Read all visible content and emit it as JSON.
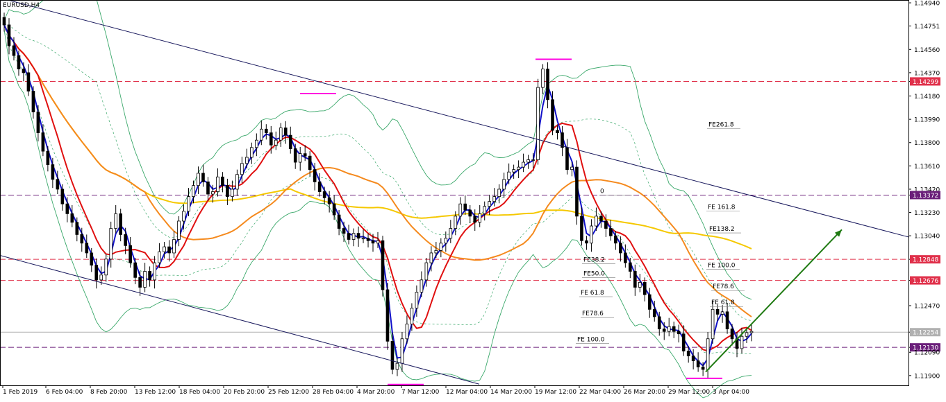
{
  "symbol_label": "EURUSD,H4",
  "chart_data": {
    "type": "candlestick",
    "symbol": "EURUSD",
    "timeframe": "H4",
    "y_range": [
      1.1183,
      1.1496
    ],
    "y_ticks": [
      1.1494,
      1.14751,
      1.1456,
      1.1437,
      1.14299,
      1.1418,
      1.1399,
      1.138,
      1.1361,
      1.1342,
      1.13372,
      1.1323,
      1.1304,
      1.12848,
      1.12676,
      1.1247,
      1.12254,
      1.1213,
      1.1209,
      1.119
    ],
    "y_tick_labels": [
      "1.14940",
      "1.14751",
      "1.14560",
      "1.14370",
      "1.14299",
      "1.14180",
      "1.13990",
      "1.13800",
      "1.13610",
      "1.13420",
      "1.13372",
      "1.13230",
      "1.13040",
      "1.12848",
      "1.12676",
      "1.12470",
      "1.12254",
      "1.12130",
      "1.12090",
      "1.11900"
    ],
    "highlighted_levels": [
      {
        "label": "1.14299",
        "value": 1.14299,
        "color": "#e0304a"
      },
      {
        "label": "1.13372",
        "value": 1.13372,
        "color": "#6a1f7a"
      },
      {
        "label": "1.12848",
        "value": 1.12848,
        "color": "#e0304a"
      },
      {
        "label": "1.12676",
        "value": 1.12676,
        "color": "#e0304a"
      },
      {
        "label": "1.12254",
        "value": 1.12254,
        "color": "#b0b0b0"
      },
      {
        "label": "1.12130",
        "value": 1.1213,
        "color": "#6a1f7a"
      }
    ],
    "x_labels": [
      "1 Feb 2019",
      "6 Feb 04:00",
      "8 Feb 20:00",
      "13 Feb 12:00",
      "18 Feb 04:00",
      "20 Feb 20:00",
      "25 Feb 12:00",
      "28 Feb 04:00",
      "4 Mar 20:00",
      "7 Mar 12:00",
      "12 Mar 04:00",
      "14 Mar 20:00",
      "19 Mar 12:00",
      "22 Mar 04:00",
      "26 Mar 20:00",
      "29 Mar 12:00",
      "3 Apr 04:00"
    ],
    "fib_labels": [
      {
        "text": "FE261.8",
        "value": 1.1393
      },
      {
        "text": "FE 161.8",
        "value": 1.1326
      },
      {
        "text": "FE138.2",
        "value": 1.1308
      },
      {
        "text": "FE 100.0",
        "value": 1.12785
      },
      {
        "text": "FE78.6",
        "value": 1.1261
      },
      {
        "text": "FE 61.8",
        "value": 1.1248
      },
      {
        "text": "FE38.2",
        "value": 1.1283
      },
      {
        "text": "FE50.0",
        "value": 1.12715
      },
      {
        "text": "FE 61.8",
        "value": 1.1256
      },
      {
        "text": "FE78.6",
        "value": 1.1239
      },
      {
        "text": "FE 100.0",
        "value": 1.1218
      },
      {
        "text": "0",
        "value": 1.1339
      }
    ],
    "swing_markers": [
      {
        "kind": "high",
        "value": 1.142
      },
      {
        "kind": "low",
        "value": 1.11827
      },
      {
        "kind": "high",
        "value": 1.1448
      },
      {
        "kind": "low",
        "value": 1.11877
      }
    ],
    "series": [
      {
        "name": "close",
        "color": "#000000",
        "values": [
          1.1476,
          1.1459,
          1.1451,
          1.144,
          1.1437,
          1.1422,
          1.1405,
          1.1388,
          1.1373,
          1.1362,
          1.135,
          1.1342,
          1.133,
          1.1322,
          1.1315,
          1.1305,
          1.1298,
          1.129,
          1.128,
          1.1268,
          1.1272,
          1.1285,
          1.131,
          1.1322,
          1.1305,
          1.1296,
          1.1282,
          1.127,
          1.1262,
          1.1275,
          1.1268,
          1.1282,
          1.1291,
          1.1295,
          1.129,
          1.1301,
          1.1316,
          1.1324,
          1.1336,
          1.1345,
          1.1355,
          1.1348,
          1.1338,
          1.134,
          1.1352,
          1.1345,
          1.1336,
          1.1342,
          1.1354,
          1.1363,
          1.1368,
          1.1376,
          1.1382,
          1.1391,
          1.1388,
          1.1378,
          1.1382,
          1.1392,
          1.1386,
          1.1375,
          1.1364,
          1.1371,
          1.1369,
          1.1358,
          1.1348,
          1.134,
          1.1335,
          1.133,
          1.1321,
          1.131,
          1.1306,
          1.1301,
          1.1306,
          1.1302,
          1.1302,
          1.13,
          1.1298,
          1.13,
          1.126,
          1.1218,
          1.1195,
          1.12,
          1.122,
          1.1232,
          1.1245,
          1.1258,
          1.1268,
          1.1282,
          1.129,
          1.1292,
          1.1298,
          1.1302,
          1.131,
          1.132,
          1.133,
          1.1325,
          1.132,
          1.1315,
          1.1322,
          1.1328,
          1.1332,
          1.1336,
          1.1342,
          1.135,
          1.1356,
          1.1358,
          1.136,
          1.1364,
          1.1366,
          1.1366,
          1.1425,
          1.144,
          1.1415,
          1.139,
          1.1388,
          1.1376,
          1.1358,
          1.136,
          1.132,
          1.13,
          1.1298,
          1.1312,
          1.132,
          1.1316,
          1.131,
          1.1304,
          1.1298,
          1.129,
          1.1282,
          1.1275,
          1.1262,
          1.1266,
          1.1256,
          1.1244,
          1.1238,
          1.1228,
          1.1226,
          1.123,
          1.1226,
          1.1224,
          1.121,
          1.1206,
          1.1202,
          1.1197,
          1.1195,
          1.122,
          1.1244,
          1.124,
          1.1242,
          1.1228,
          1.122,
          1.1212,
          1.1222,
          1.1225,
          1.1226
        ]
      },
      {
        "name": "SMA 5",
        "color": "#1010c8"
      },
      {
        "name": "SMA 10",
        "color": "#e01010"
      },
      {
        "name": "SMA 50",
        "color": "#f58a1e"
      },
      {
        "name": "SMA 100",
        "color": "#f5c800"
      },
      {
        "name": "Bollinger",
        "color": "#3aa86a"
      }
    ],
    "overlays": {
      "upper_channel_from": [
        1.1498,
        0
      ],
      "upper_channel_to": [
        1.1303,
        1
      ],
      "lower_channel_from": [
        1.1288,
        0
      ],
      "lower_channel_to": [
        1.1183,
        1
      ],
      "forecast_arrow_from": 1.1193,
      "forecast_arrow_to": 1.1309
    },
    "grid": false,
    "legend": "none"
  }
}
